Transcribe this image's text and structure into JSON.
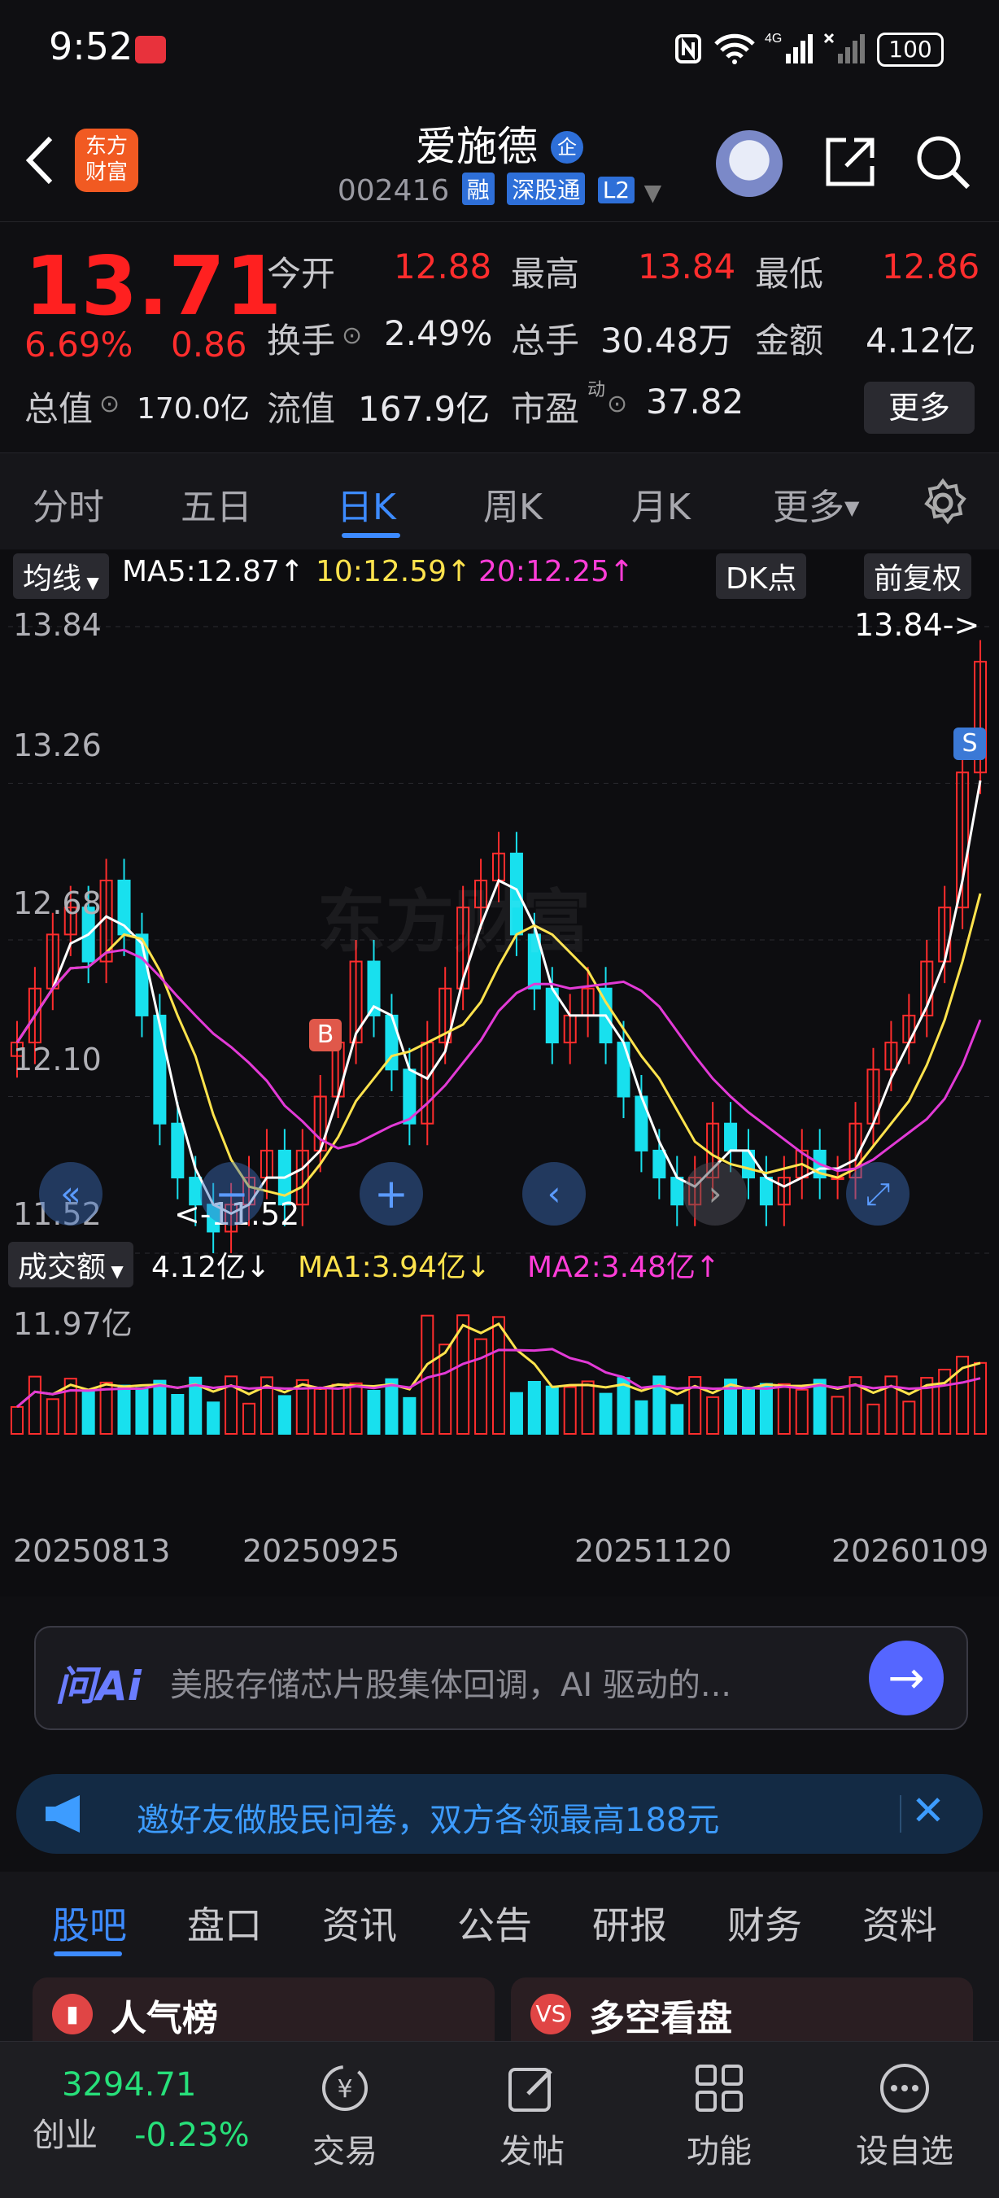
{
  "status_bar": {
    "time": "9:52",
    "battery": "100"
  },
  "header": {
    "logo_line1": "东方",
    "logo_line2": "财富",
    "stock_name": "爱施德",
    "stock_badge": "企",
    "stock_code": "002416",
    "tags": [
      "融",
      "深股通",
      "L2"
    ]
  },
  "quote": {
    "price": "13.71",
    "change_pct": "6.69%",
    "change_amt": "0.86",
    "labels": {
      "open": "今开",
      "high": "最高",
      "low": "最低",
      "turnover": "换手",
      "volume": "总手",
      "amount": "金额",
      "total_cap": "总值",
      "float_cap": "流值",
      "pe": "市盈"
    },
    "pe_sup": "动",
    "open": "12.88",
    "high": "13.84",
    "low": "12.86",
    "turnover": "2.49%",
    "volume": "30.48万",
    "amount": "4.12亿",
    "total_cap": "170.0亿",
    "float_cap": "167.9亿",
    "pe": "37.82",
    "more_label": "更多"
  },
  "kline_tabs": [
    "分时",
    "五日",
    "日K",
    "周K",
    "月K",
    "更多"
  ],
  "chart": {
    "ma_chip": "均线",
    "ma5": "MA5:12.87↑",
    "ma10": "10:12.59↑",
    "ma20": "20:12.25↑",
    "dk_chip": "DK点",
    "adjust_chip": "前复权",
    "high_marker": "13.84->",
    "low_marker": "<-11.52",
    "buy_marker": "B",
    "sell_marker": "S",
    "watermark": "东方财富",
    "y_ticks": [
      "13.84",
      "13.26",
      "12.68",
      "12.10",
      "11.52"
    ],
    "vol_chip": "成交额",
    "vol_value": "4.12亿↓",
    "vol_ma1": "MA1:3.94亿↓",
    "vol_ma2": "MA2:3.48亿↑",
    "vol_max": "11.97亿",
    "x_dates": [
      "20250813",
      "20250925",
      "20251120",
      "20260109"
    ],
    "colors": {
      "up": "#ff2d2d",
      "down": "#18e0ee",
      "ma5": "#ffffff",
      "ma10": "#ffe34d",
      "ma20": "#e23ad6"
    }
  },
  "chart_data": {
    "type": "candlestick",
    "ylim": [
      11.52,
      13.84
    ],
    "volume_ylim": [
      0,
      11.97
    ],
    "volume_unit": "亿",
    "x_range": [
      "20250813",
      "20260109"
    ],
    "close_series_approx": [
      12.3,
      12.5,
      12.7,
      12.8,
      12.6,
      12.9,
      12.7,
      12.4,
      12.0,
      11.8,
      11.7,
      11.6,
      11.7,
      11.8,
      11.9,
      11.7,
      11.9,
      12.1,
      12.3,
      12.6,
      12.4,
      12.2,
      12.0,
      12.3,
      12.5,
      12.8,
      12.9,
      13.0,
      12.7,
      12.5,
      12.3,
      12.4,
      12.5,
      12.3,
      12.1,
      11.9,
      11.8,
      11.7,
      11.8,
      12.0,
      11.9,
      11.8,
      11.7,
      11.8,
      11.9,
      11.8,
      11.8,
      12.0,
      12.2,
      12.3,
      12.4,
      12.6,
      12.8,
      13.3,
      13.71
    ]
  },
  "ai_bar": {
    "logo": "问Ai",
    "placeholder": "美股存储芯片股集体回调，AI 驱动的..."
  },
  "banner": {
    "text": "邀好友做股民问卷，双方各领最高188元"
  },
  "section_tabs": [
    "股吧",
    "盘口",
    "资讯",
    "公告",
    "研报",
    "财务",
    "资料"
  ],
  "cards": {
    "left": "人气榜",
    "right": "多空看盘"
  },
  "bottom_nav": {
    "index_value": "3294.71",
    "index_name": "创业",
    "index_change": "-0.23%",
    "items": [
      "交易",
      "发帖",
      "功能",
      "设自选"
    ]
  }
}
